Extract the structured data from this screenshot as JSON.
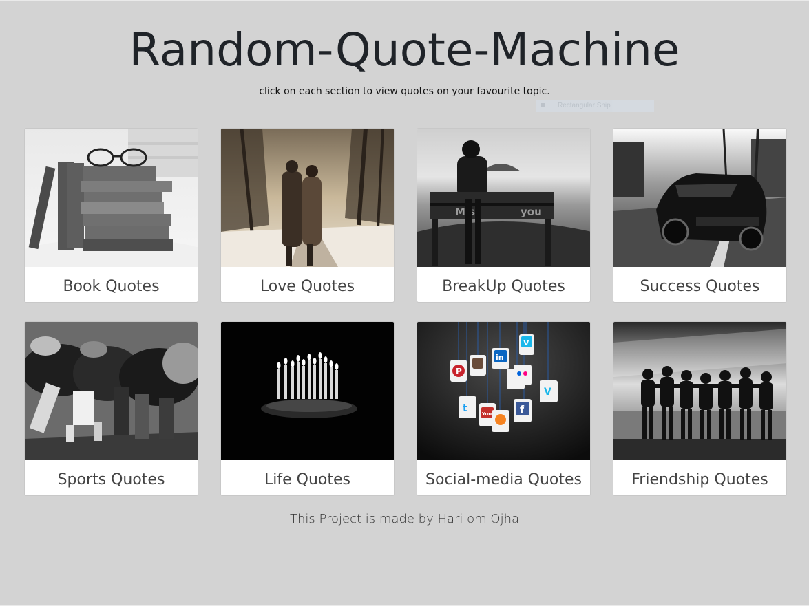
{
  "header": {
    "title": "Random-Quote-Machine",
    "subtitle": "click on each section to view quotes on your favourite topic."
  },
  "overlay": {
    "snip_label": "Rectangular Snip"
  },
  "cards": [
    {
      "label": "Book Quotes",
      "image": "stacked-books-with-glasses"
    },
    {
      "label": "Love Quotes",
      "image": "couple-walking-in-snowy-park"
    },
    {
      "label": "BreakUp Quotes",
      "image": "woman-on-miss-you-bench"
    },
    {
      "label": "Success Quotes",
      "image": "black-muscle-car"
    },
    {
      "label": "Sports Quotes",
      "image": "rugby-scrum"
    },
    {
      "label": "Life Quotes",
      "image": "birthday-candles-in-dark"
    },
    {
      "label": "Social-media Quotes",
      "image": "hanging-social-media-icons"
    },
    {
      "label": "Friendship Quotes",
      "image": "friends-arm-in-arm"
    }
  ],
  "images_text": {
    "bench_left": "Miss",
    "bench_right": "you",
    "social_in": "in",
    "social_f": "f",
    "social_v": "V",
    "social_v2": "V",
    "social_p": "P",
    "social_t": "t",
    "social_yt": "You"
  },
  "footer": {
    "credit": "This Project is made by Hari om Ojha"
  }
}
